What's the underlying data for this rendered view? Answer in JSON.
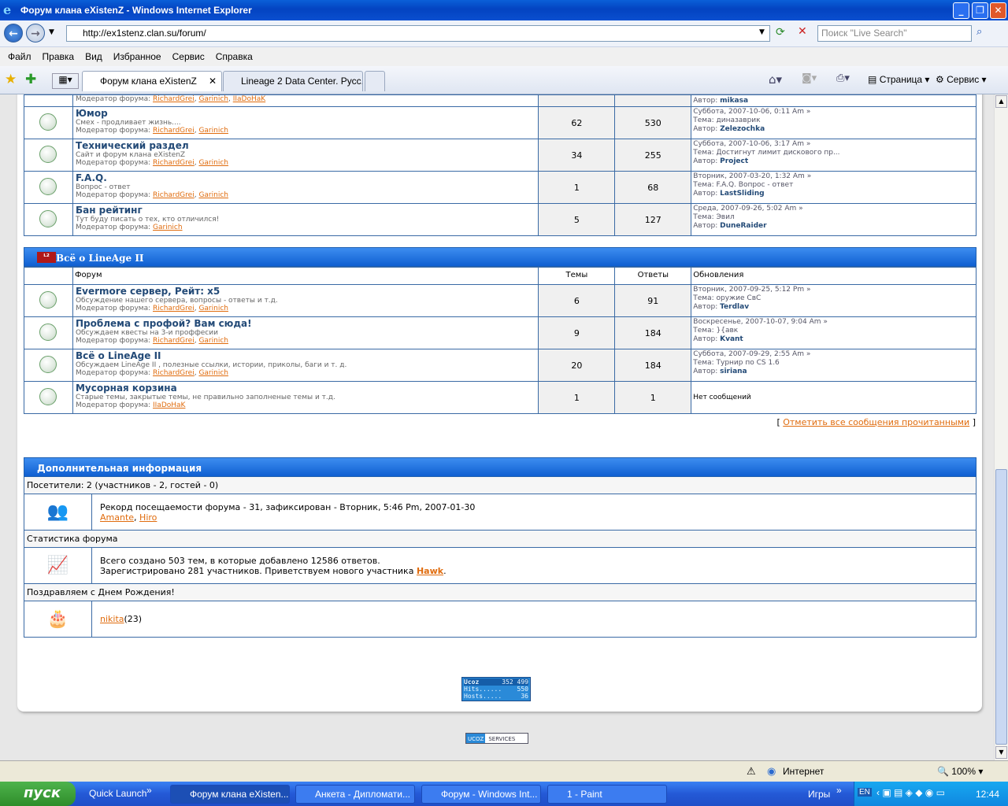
{
  "window": {
    "title": "Форум клана eXistenZ - Windows Internet Explorer"
  },
  "addressbar": {
    "url": "http://ex1stenz.clan.su/forum/",
    "search_placeholder": "Поиск \"Live Search\""
  },
  "menu": [
    "Файл",
    "Правка",
    "Вид",
    "Избранное",
    "Сервис",
    "Справка"
  ],
  "tabs": [
    {
      "label": "Форум клана eXistenZ"
    },
    {
      "label": "Lineage 2 Data Center. Русс..."
    }
  ],
  "command_bar": {
    "page": "Страница",
    "tools": "Сервис"
  },
  "forums_top": [
    {
      "name": "",
      "desc": "",
      "moderators_label": "Модератор форума:",
      "moderators": [
        "RichardGrei",
        "Garinich",
        "IIaDoHaK"
      ],
      "topics": "",
      "replies": "",
      "last": {
        "date": "",
        "topic": "",
        "author_label": "Автор:",
        "author": "mikasa"
      }
    },
    {
      "name": "Юмор",
      "desc": "Смех - продливает жизнь....",
      "moderators_label": "Модератор форума:",
      "moderators": [
        "RichardGrei",
        "Garinich"
      ],
      "topics": "62",
      "replies": "530",
      "last": {
        "date": "Суббота, 2007-10-06, 0:11 Am",
        "topic_label": "Тема:",
        "topic": "диназаврик",
        "author_label": "Автор:",
        "author": "Zelezochka"
      }
    },
    {
      "name": "Технический раздел",
      "desc": "Сайт и форум клана eXistenZ",
      "moderators_label": "Модератор форума:",
      "moderators": [
        "RichardGrei",
        "Garinich"
      ],
      "topics": "34",
      "replies": "255",
      "last": {
        "date": "Суббота, 2007-10-06, 3:17 Am",
        "topic_label": "Тема:",
        "topic": "Достигнут лимит дискового пр...",
        "author_label": "Автор:",
        "author": "Project"
      }
    },
    {
      "name": "F.A.Q.",
      "desc": "Вопрос - ответ",
      "moderators_label": "Модератор форума:",
      "moderators": [
        "RichardGrei",
        "Garinich"
      ],
      "topics": "1",
      "replies": "68",
      "last": {
        "date": "Вторник, 2007-03-20, 1:32 Am",
        "topic_label": "Тема:",
        "topic": "F.A.Q. Вопрос - ответ",
        "author_label": "Автор:",
        "author": "LastSliding"
      }
    },
    {
      "name": "Бан рейтинг",
      "desc": "Тут буду писать о тех, кто отличился!",
      "moderators_label": "Модератор форума:",
      "moderators": [
        "Garinich"
      ],
      "topics": "5",
      "replies": "127",
      "last": {
        "date": "Среда, 2007-09-26, 5:02 Am",
        "topic_label": "Тема:",
        "topic": "Эвил",
        "author_label": "Автор:",
        "author": "DuneRaider"
      }
    }
  ],
  "section2": {
    "title": "Всё о LineAge II",
    "col_forum": "Форум",
    "col_topics": "Темы",
    "col_replies": "Ответы",
    "col_updates": "Обновления"
  },
  "forums_l2": [
    {
      "name": "Evermore сервер, Рейт: x5",
      "desc": "Обсуждение нашего сервера, вопросы - ответы и т.д.",
      "moderators_label": "Модератор форума:",
      "moderators": [
        "RichardGrei",
        "Garinich"
      ],
      "topics": "6",
      "replies": "91",
      "last": {
        "date": "Вторник, 2007-09-25, 5:12 Pm",
        "topic_label": "Тема:",
        "topic": "оружие СвС",
        "author_label": "Автор:",
        "author": "Terdlav"
      }
    },
    {
      "name": "Проблема с профой? Вам сюда!",
      "desc": "Обсуждаем квесты на 3-и проффесии",
      "moderators_label": "Модератор форума:",
      "moderators": [
        "RichardGrei",
        "Garinich"
      ],
      "topics": "9",
      "replies": "184",
      "last": {
        "date": "Воскресенье, 2007-10-07, 9:04 Am",
        "topic_label": "Тема:",
        "topic": "}{авк",
        "author_label": "Автор:",
        "author": "Kvant"
      }
    },
    {
      "name": "Всё о LineAge II",
      "desc": "Обсуждаем LineAge II , полезные ссылки, истории, приколы, баги и т. д.",
      "moderators_label": "Модератор форума:",
      "moderators": [
        "RichardGrei",
        "Garinich"
      ],
      "topics": "20",
      "replies": "184",
      "last": {
        "date": "Суббота, 2007-09-29, 2:55 Am",
        "topic_label": "Тема:",
        "topic": "Турнир по CS 1.6",
        "author_label": "Автор:",
        "author": "siriana"
      }
    },
    {
      "name": "Мусорная корзина",
      "desc": "Старые темы, закрытые темы, не правильно заполненые темы и т.д.",
      "moderators_label": "Модератор форума:",
      "moderators": [
        "IIaDoHaK"
      ],
      "topics": "1",
      "replies": "1",
      "last": {
        "no_messages": "Нет сообщений"
      }
    }
  ],
  "mark_read": "Отметить все сообщения прочитанными",
  "info": {
    "title": "Дополнительная информация",
    "visitors": "Посетители: 2  (участников - 2, гостей - 0)",
    "record": "Рекорд посещаемости форума - 31, зафиксирован - Вторник, 5:46 Pm, 2007-01-30",
    "record_users": [
      "Amante",
      "Hiro"
    ],
    "stats_label": "Статистика форума",
    "stats_line1": "Всего создано 503 тем, в которые добавлено 12586 ответов.",
    "stats_line2_pre": "Зарегистрировано 281 участников. Приветствуем нового участника ",
    "new_member": "Hawk",
    "birthday_label": "Поздравляем с Днем Рождения!",
    "birthday_user": "nikita",
    "birthday_age": "(23)"
  },
  "counter": {
    "brand": "Ucoz",
    "total": "352 499",
    "hits_label": "Hits......",
    "hits": "550",
    "hosts_label": "Hosts.....",
    "hosts": "36"
  },
  "services_badge": {
    "left": "UCOZ",
    "right": "SERVICES"
  },
  "status": {
    "zone": "Интернет",
    "zoom": "100%"
  },
  "taskbar": {
    "start": "пуск",
    "quick_launch": "Quick Launch",
    "items": [
      "Форум клана eXisten...",
      "Анкета - Дипломати...",
      "Форум - Windows Int...",
      "1 - Paint"
    ],
    "games": "Игры",
    "lang": "EN",
    "clock": "12:44"
  }
}
